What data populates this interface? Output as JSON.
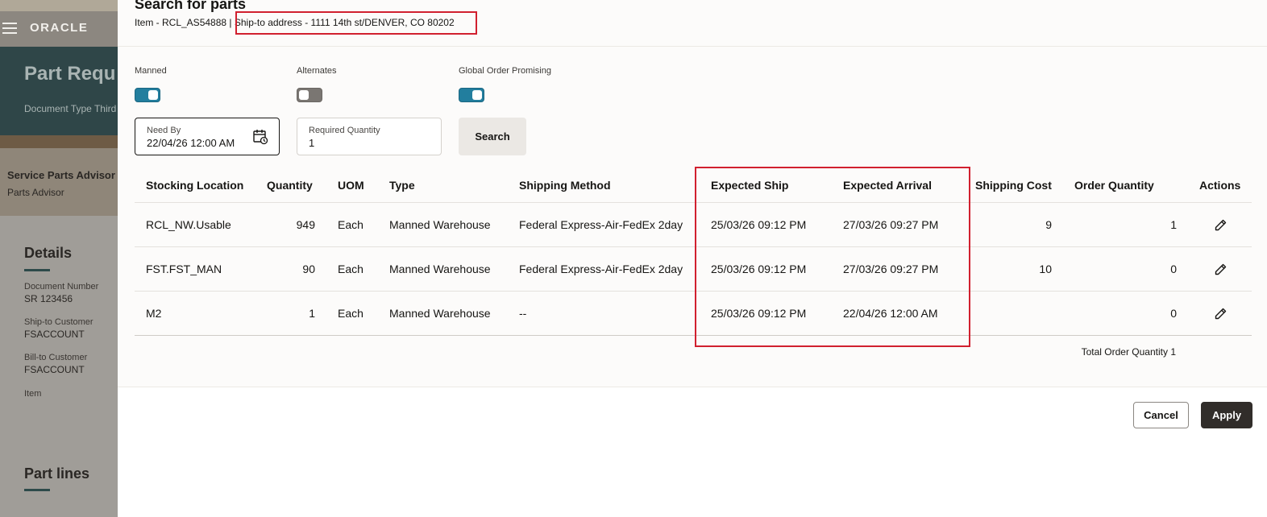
{
  "background": {
    "brand": "ORACLE",
    "hero_title": "Part Requ",
    "hero_subtitle": "Document Type Third",
    "advisor_title": "Service Parts Advisor",
    "advisor_subtitle": "Parts Advisor",
    "details_title": "Details",
    "fields": [
      {
        "label": "Document Number",
        "value": "SR 123456"
      },
      {
        "label": "Ship-to Customer",
        "value": "FSACCOUNT"
      },
      {
        "label": "Bill-to Customer",
        "value": "FSACCOUNT"
      },
      {
        "label": "Item",
        "value": ""
      }
    ],
    "part_lines_title": "Part lines"
  },
  "drawer": {
    "title": "Search for parts",
    "subtitle_prefix": "Item - RCL_AS54888 | ",
    "subtitle_address": "Ship-to address - 1111 14th st/DENVER, CO 80202"
  },
  "toggles": [
    {
      "label": "Manned",
      "on": true
    },
    {
      "label": "Alternates",
      "on": false
    },
    {
      "label": "Global Order Promising",
      "on": true
    }
  ],
  "need_by": {
    "label": "Need By",
    "value": "22/04/26 12:00 AM"
  },
  "required_quantity": {
    "label": "Required Quantity",
    "value": "1"
  },
  "search_label": "Search",
  "table": {
    "columns": [
      "Stocking Location",
      "Quantity",
      "UOM",
      "Type",
      "Shipping Method",
      "Expected Ship",
      "Expected Arrival",
      "Shipping Cost",
      "Order Quantity",
      "Actions"
    ],
    "rows": [
      {
        "location": "RCL_NW.Usable",
        "quantity": "949",
        "uom": "Each",
        "type": "Manned Warehouse",
        "method": "Federal Express-Air-FedEx 2day",
        "ship": "25/03/26 09:12 PM",
        "arrival": "27/03/26 09:27 PM",
        "cost": "9",
        "order_qty": "1"
      },
      {
        "location": "FST.FST_MAN",
        "quantity": "90",
        "uom": "Each",
        "type": "Manned Warehouse",
        "method": "Federal Express-Air-FedEx 2day",
        "ship": "25/03/26 09:12 PM",
        "arrival": "27/03/26 09:27 PM",
        "cost": "10",
        "order_qty": "0"
      },
      {
        "location": "M2",
        "quantity": "1",
        "uom": "Each",
        "type": "Manned Warehouse",
        "method": "--",
        "ship": "25/03/26 09:12 PM",
        "arrival": "22/04/26 12:00 AM",
        "cost": "",
        "order_qty": "0"
      }
    ]
  },
  "total_label": "Total Order Quantity 1",
  "footer": {
    "cancel": "Cancel",
    "apply": "Apply"
  },
  "colors": {
    "accent": "#227e9e",
    "highlight": "#d1202f",
    "primary_button": "#312d2a"
  }
}
